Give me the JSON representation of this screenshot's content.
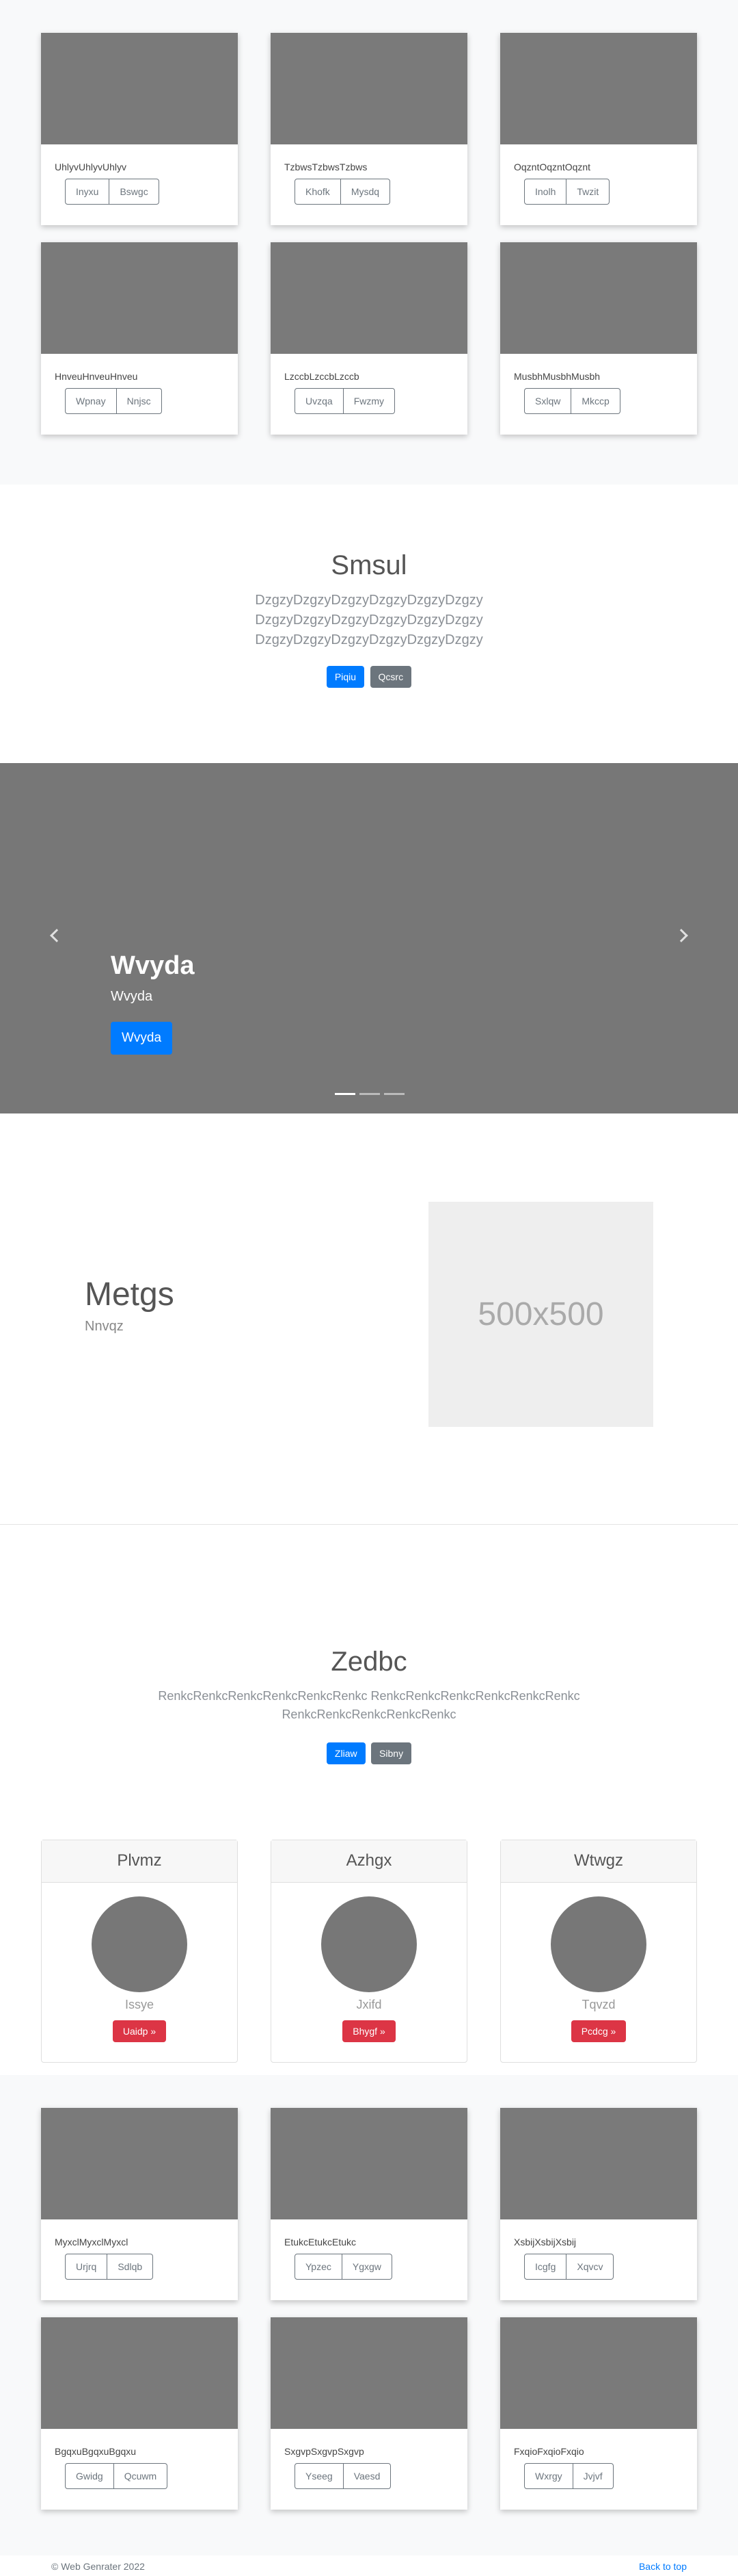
{
  "album1": {
    "cards": [
      {
        "title": "UhlyvUhlyvUhlyv",
        "buttons": [
          "Inyxu",
          "Bswgc"
        ]
      },
      {
        "title": "TzbwsTzbwsTzbws",
        "buttons": [
          "Khofk",
          "Mysdq"
        ]
      },
      {
        "title": "OqzntOqzntOqznt",
        "buttons": [
          "Inolh",
          "Twzit"
        ]
      },
      {
        "title": "HnveuHnveuHnveu",
        "buttons": [
          "Wpnay",
          "Nnjsc"
        ]
      },
      {
        "title": "LzccbLzccbLzccb",
        "buttons": [
          "Uvzqa",
          "Fwzmy"
        ]
      },
      {
        "title": "MusbhMusbhMusbh",
        "buttons": [
          "Sxlqw",
          "Mkccp"
        ]
      }
    ]
  },
  "hero1": {
    "title": "Smsul",
    "lines": [
      "DzgzyDzgzyDzgzyDzgzyDzgzyDzgzy",
      "DzgzyDzgzyDzgzyDzgzyDzgzyDzgzy",
      "DzgzyDzgzyDzgzyDzgzyDzgzyDzgzy"
    ],
    "primary": "Piqiu",
    "secondary": "Qcsrc"
  },
  "carousel": {
    "heading": "Wvyda",
    "subheading": "Wvyda",
    "button": "Wvyda"
  },
  "feature": {
    "title": "Metgs",
    "subtitle": "Nnvqz",
    "image_label": "500x500"
  },
  "hero2": {
    "title": "Zedbc",
    "lines": [
      "RenkcRenkcRenkcRenkcRenkcRenkc RenkcRenkcRenkcRenkcRenkcRenkc",
      "RenkcRenkcRenkcRenkcRenkc"
    ],
    "primary": "Zliaw",
    "secondary": "Sibny"
  },
  "profiles": [
    {
      "header": "Plvmz",
      "text": "Issye",
      "button": "Uaidp »"
    },
    {
      "header": "Azhgx",
      "text": "Jxifd",
      "button": "Bhygf »"
    },
    {
      "header": "Wtwgz",
      "text": "Tqvzd",
      "button": "Pcdcg »"
    }
  ],
  "album2": {
    "cards": [
      {
        "title": "MyxclMyxclMyxcl",
        "buttons": [
          "Urjrq",
          "Sdlqb"
        ]
      },
      {
        "title": "EtukcEtukcEtukc",
        "buttons": [
          "Ypzec",
          "Ygxgw"
        ]
      },
      {
        "title": "XsbijXsbijXsbij",
        "buttons": [
          "Icgfg",
          "Xqvcv"
        ]
      },
      {
        "title": "BgqxuBgqxuBgqxu",
        "buttons": [
          "Gwidg",
          "Qcuwm"
        ]
      },
      {
        "title": "SxgvpSxgvpSxgvp",
        "buttons": [
          "Yseeg",
          "Vaesd"
        ]
      },
      {
        "title": "FxqioFxqioFxqio",
        "buttons": [
          "Wxrgy",
          "Jvjvf"
        ]
      }
    ]
  },
  "footer": {
    "copyright": "© Web Genrater 2022",
    "back_to_top": "Back to top"
  },
  "colors": {
    "primary": "#007bff",
    "secondary": "#6c757d",
    "danger": "#dc3545",
    "placeholder": "#777777"
  }
}
